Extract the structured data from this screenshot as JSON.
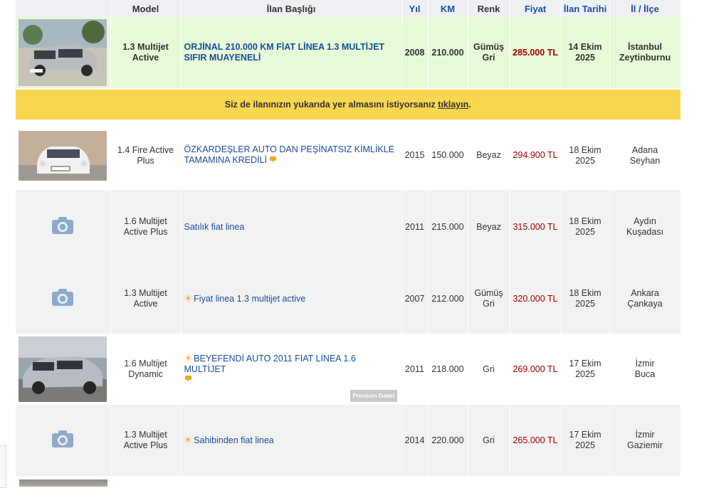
{
  "header": {
    "photo": "",
    "model": "Model",
    "title": "İlan Başlığı",
    "year": "Yıl",
    "km": "KM",
    "color": "Renk",
    "price": "Fiyat",
    "date": "İlan Tarihi",
    "location": "İl / İlçe"
  },
  "promo": {
    "text_before": "Siz de ilanınızın yukarıda yer almasını istiyorsanız ",
    "link": "tıklayın",
    "text_after": "."
  },
  "listings": [
    {
      "model_l1": "1.3 Multijet",
      "model_l2": "Active",
      "title": "ORJİNAL 210.000 KM FİAT LİNEA 1.3 MULTİJET SIFIR MUAYENELİ",
      "year": "2008",
      "km": "210.000",
      "color_l1": "Gümüş",
      "color_l2": "Gri",
      "price": "285.000 TL",
      "date_l1": "14 Ekim",
      "date_l2": "2025",
      "city": "İstanbul",
      "district": "Zeytinburnu"
    },
    {
      "model_l1": "1.4 Fire Active",
      "model_l2": "Plus",
      "title": "ÖZKARDEŞLER AUTO DAN PEŞİNATSIZ KİMLİKLE TAMAMINA KREDİLİ",
      "year": "2015",
      "km": "150.000",
      "color_l1": "Beyaz",
      "color_l2": "",
      "price": "294.900 TL",
      "date_l1": "18 Ekim",
      "date_l2": "2025",
      "city": "Adana",
      "district": "Seyhan"
    },
    {
      "model_l1": "1.6 Multijet",
      "model_l2": "Active Plus",
      "title": "Satılık fiat linea",
      "year": "2011",
      "km": "215.000",
      "color_l1": "Beyaz",
      "color_l2": "",
      "price": "315.000 TL",
      "date_l1": "18 Ekim",
      "date_l2": "2025",
      "city": "Aydın",
      "district": "Kuşadası"
    },
    {
      "model_l1": "1.3 Multijet",
      "model_l2": "Active",
      "title": "Fiyat linea 1.3 multijet active",
      "year": "2007",
      "km": "212.000",
      "color_l1": "Gümüş",
      "color_l2": "Gri",
      "price": "320.000 TL",
      "date_l1": "18 Ekim",
      "date_l2": "2025",
      "city": "Ankara",
      "district": "Çankaya"
    },
    {
      "model_l1": "1.6 Multijet",
      "model_l2": "Dynamic",
      "title": "BEYEFENDİ AUTO 2011 FIAT LİNEA 1.6 MULTİJET",
      "year": "2011",
      "km": "218.000",
      "color_l1": "Gri",
      "color_l2": "",
      "price": "269.000 TL",
      "date_l1": "17 Ekim",
      "date_l2": "2025",
      "city": "İzmir",
      "district": "Buca",
      "badge": "Premium Galeri"
    },
    {
      "model_l1": "1.3 Multijet",
      "model_l2": "Active Plus",
      "title": "Sahibinden fiat linea",
      "year": "2014",
      "km": "220.000",
      "color_l1": "Gri",
      "color_l2": "",
      "price": "265.000 TL",
      "date_l1": "17 Ekim",
      "date_l2": "2025",
      "city": "İzmir",
      "district": "Gaziemir"
    }
  ],
  "colors": {
    "link": "#1a4d9c",
    "price": "#a60000",
    "featured_bg": "#e7fad8",
    "promo_bg": "#f9d64f",
    "header_bg": "#eef0f4",
    "row_alt": "#f2f2f2"
  },
  "icons": {
    "camera": "camera-icon",
    "star": "highlight-star-icon",
    "comment": "speech-bubble-icon"
  }
}
